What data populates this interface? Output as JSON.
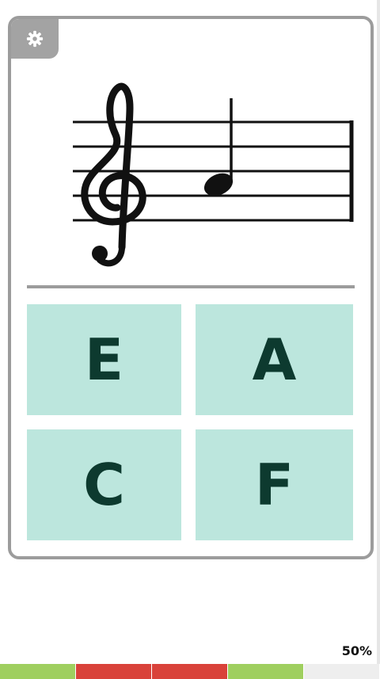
{
  "quiz": {
    "clef": "treble-clef",
    "note": "quarter-note",
    "answers": [
      {
        "label": "E"
      },
      {
        "label": "A"
      },
      {
        "label": "C"
      },
      {
        "label": "F"
      }
    ]
  },
  "settings": {
    "icon": "gear-icon"
  },
  "progress": {
    "percent_label": "50%",
    "percent": 50,
    "segments": [
      {
        "status": "correct",
        "color": "#9fcf5f"
      },
      {
        "status": "wrong",
        "color": "#d9423a"
      },
      {
        "status": "wrong",
        "color": "#d9423a"
      },
      {
        "status": "correct",
        "color": "#9fcf5f"
      },
      {
        "status": "pending",
        "color": "#eeeeee"
      }
    ]
  },
  "colors": {
    "answer_bg": "#bce6dd",
    "answer_text": "#0d3a2f",
    "border": "#9c9c9c"
  }
}
